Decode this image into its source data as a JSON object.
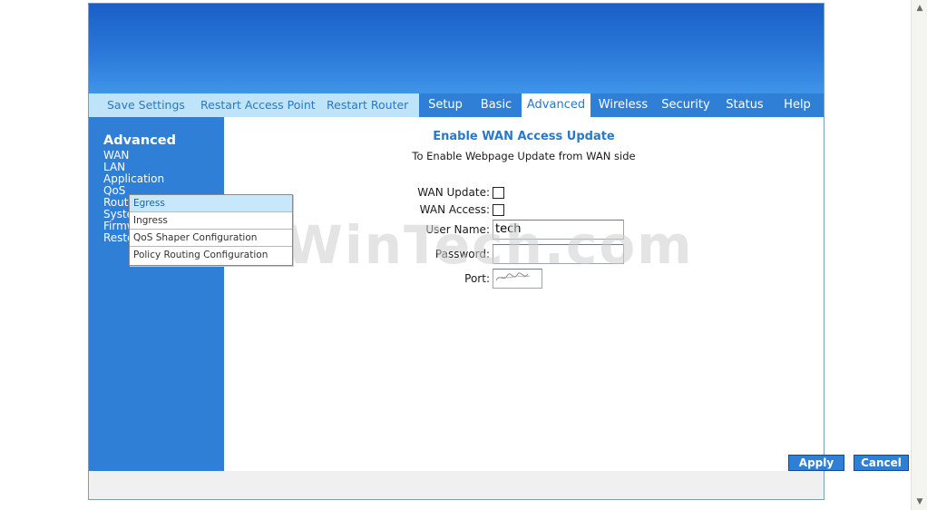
{
  "nav": {
    "left_links": [
      {
        "label": "Save Settings"
      },
      {
        "label": "Restart Access Point"
      },
      {
        "label": "Restart Router"
      }
    ],
    "tabs": [
      {
        "label": "Setup"
      },
      {
        "label": "Basic"
      },
      {
        "label": "Advanced"
      },
      {
        "label": "Wireless"
      },
      {
        "label": "Security"
      },
      {
        "label": "Status"
      },
      {
        "label": "Help"
      }
    ],
    "active_tab": "Advanced"
  },
  "sidebar": {
    "title": "Advanced",
    "items": [
      {
        "label": "WAN"
      },
      {
        "label": "LAN"
      },
      {
        "label": "Application"
      },
      {
        "label": "QoS"
      },
      {
        "label": "Rout"
      },
      {
        "label": "Syste"
      },
      {
        "label": "Firmw"
      },
      {
        "label": "Resto"
      }
    ]
  },
  "submenu": {
    "items": [
      {
        "label": "Egress"
      },
      {
        "label": "Ingress"
      },
      {
        "label": "QoS Shaper Configuration"
      },
      {
        "label": "Policy Routing Configuration"
      }
    ],
    "selected": "Egress"
  },
  "content": {
    "title": "Enable WAN Access Update",
    "subtitle": "To Enable Webpage Update from WAN side",
    "fields": {
      "wan_update_label": "WAN Update:",
      "wan_access_label": "WAN Access:",
      "username_label": "User Name:",
      "username_value": "tech",
      "password_label": "Password:",
      "port_label": "Port:"
    }
  },
  "buttons": {
    "apply": "Apply",
    "cancel": "Cancel"
  },
  "watermark": "PcWinTech.com",
  "colors": {
    "accent": "#2f7fd6",
    "link": "#2a78c8",
    "nav_left_bg": "#bfe3f9",
    "submenu_selected": "#c7e8fb"
  }
}
